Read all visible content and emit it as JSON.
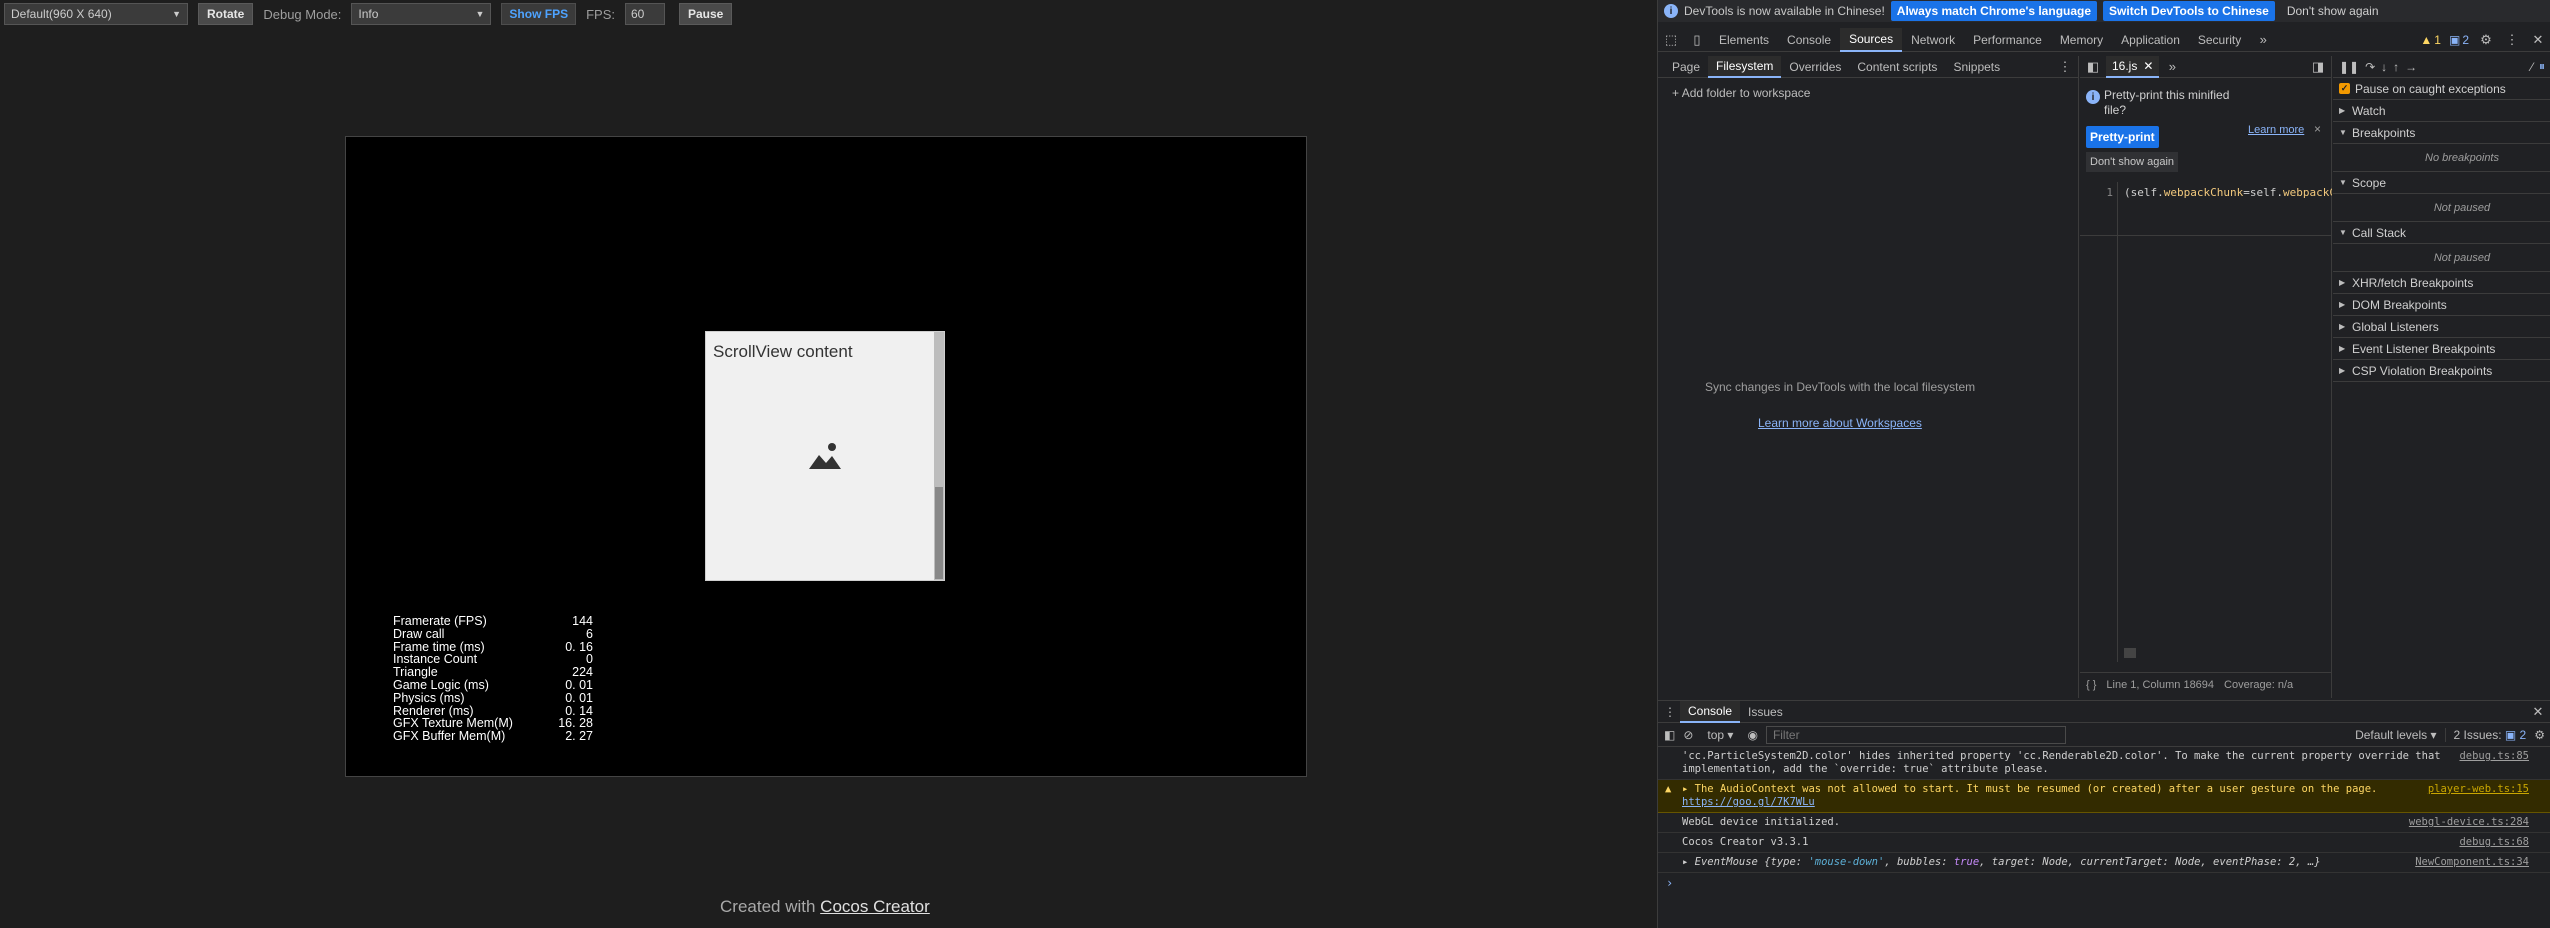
{
  "game": {
    "resolution_select": "Default(960 X 640)",
    "rotate_label": "Rotate",
    "debug_mode_label": "Debug Mode:",
    "debug_mode_value": "Info",
    "show_fps_label": "Show FPS",
    "fps_label": "FPS:",
    "fps_value": "60",
    "pause_label": "Pause",
    "scrollview_title": "ScrollView content",
    "stats": [
      {
        "k": "Framerate (FPS)",
        "v": "144"
      },
      {
        "k": "Draw call",
        "v": "6"
      },
      {
        "k": "Frame time (ms)",
        "v": "0. 16"
      },
      {
        "k": "Instance Count",
        "v": "0"
      },
      {
        "k": "Triangle",
        "v": "224"
      },
      {
        "k": "Game Logic (ms)",
        "v": "0. 01"
      },
      {
        "k": "Physics (ms)",
        "v": "0. 01"
      },
      {
        "k": "Renderer (ms)",
        "v": "0. 14"
      },
      {
        "k": "GFX Texture Mem(M)",
        "v": "16. 28"
      },
      {
        "k": "GFX Buffer Mem(M)",
        "v": "2. 27"
      }
    ],
    "credit_prefix": "Created with ",
    "credit_link": "Cocos Creator"
  },
  "devtools": {
    "infobar": {
      "message": "DevTools is now available in Chinese!",
      "btn_match": "Always match Chrome's language",
      "btn_switch": "Switch DevTools to Chinese",
      "btn_dont": "Don't show again"
    },
    "tabs": [
      "Elements",
      "Console",
      "Sources",
      "Network",
      "Performance",
      "Memory",
      "Application",
      "Security"
    ],
    "warn_count": "1",
    "issue_count": "2",
    "nav_tabs": [
      "Page",
      "Filesystem",
      "Overrides",
      "Content scripts",
      "Snippets"
    ],
    "add_folder": "Add folder to workspace",
    "sync_text": "Sync changes in DevTools with the local filesystem",
    "workspaces_link": "Learn more about Workspaces",
    "editor_tab": "16.js",
    "pp_message": "Pretty-print this minified file?",
    "pp_button": "Pretty-print",
    "pp_learn": "Learn more",
    "pp_dont": "Don't show again",
    "line_no": "1",
    "code_prefix": "(self.",
    "code_prop1": "webpackChunk",
    "code_mid": "=self.",
    "code_prop2": "webpackC",
    "status_position": "Line 1, Column 18694",
    "status_coverage": "Coverage: n/a",
    "pause_exceptions": "Pause on caught exceptions",
    "watch": "Watch",
    "breakpoints": "Breakpoints",
    "no_breakpoints": "No breakpoints",
    "scope": "Scope",
    "not_paused_1": "Not paused",
    "call_stack": "Call Stack",
    "not_paused_2": "Not paused",
    "xhr": "XHR/fetch Breakpoints",
    "dom": "DOM Breakpoints",
    "global": "Global Listeners",
    "event": "Event Listener Breakpoints",
    "csp": "CSP Violation Breakpoints",
    "drawer_tabs": [
      "Console",
      "Issues"
    ],
    "context": "top",
    "filter_placeholder": "Filter",
    "levels": "Default levels",
    "issues_btn": "2 Issues:",
    "issues_btn_count": "2",
    "console": {
      "l1_text": "'cc.ParticleSystem2D.color' hides inherited property 'cc.Renderable2D.color'. To make the current property override that implementation, add the `override: true` attribute please.",
      "l1_src": "debug.ts:85",
      "l2_text": "The AudioContext was not allowed to start. It must be resumed (or created) after a user gesture on the page.",
      "l2_link": "https://goo.gl/7K7WLu",
      "l2_src": "player-web.ts:15",
      "l3_text": "WebGL device initialized.",
      "l3_src": "webgl-device.ts:284",
      "l4_text": "Cocos Creator v3.3.1",
      "l4_src": "debug.ts:68",
      "l5_prefix": "EventMouse {type: ",
      "l5_str": "'mouse-down'",
      "l5_mid": ", bubbles: ",
      "l5_kw": "true",
      "l5_rest": ", target: Node, currentTarget: Node, eventPhase: 2, …}",
      "l5_src": "NewComponent.ts:34"
    }
  }
}
